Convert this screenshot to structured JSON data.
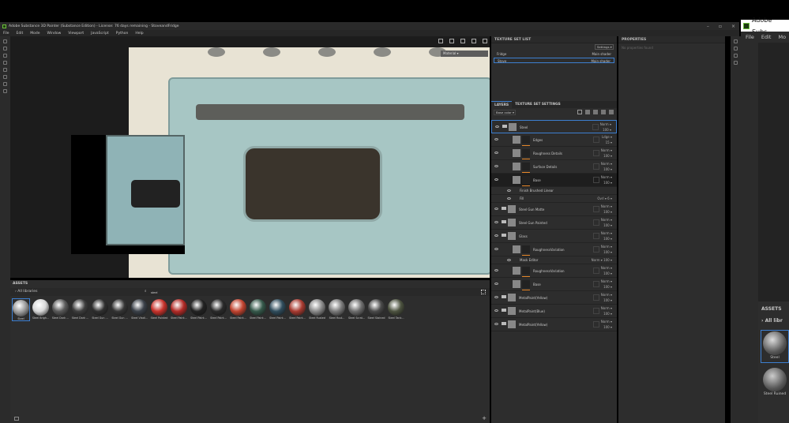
{
  "window": {
    "title": "Adobe Substance 3D Painter (Substance Edition) - License: 76 days remaining - StoveandFridge"
  },
  "menu": [
    "File",
    "Edit",
    "Mode",
    "Window",
    "Viewport",
    "JavaScript",
    "Python",
    "Help"
  ],
  "viewport": {
    "material_mode": "Material"
  },
  "texture_set_list": {
    "title": "TEXTURE SET LIST",
    "settings": "Settings",
    "items": [
      {
        "name": "Fridge",
        "shader": "Main shader"
      },
      {
        "name": "Stove",
        "shader": "Main shader",
        "selected": true
      }
    ]
  },
  "properties": {
    "title": "PROPERTIES",
    "empty": "No properties found"
  },
  "layers": {
    "tabs": [
      "LAYERS",
      "TEXTURE SET SETTINGS"
    ],
    "channel": "Base color",
    "rows": [
      {
        "name": "Steel",
        "type": "folder",
        "blend": "Norm",
        "opacity": "100",
        "indent": 0,
        "selected": true
      },
      {
        "name": "Edges",
        "type": "fill",
        "blend": "Ldge",
        "opacity": "15",
        "indent": 1
      },
      {
        "name": "Roughness Details",
        "type": "fill",
        "blend": "Norm",
        "opacity": "100",
        "indent": 1
      },
      {
        "name": "Surface Details",
        "type": "fill",
        "blend": "Norm",
        "opacity": "100",
        "indent": 1
      },
      {
        "name": "Base",
        "type": "fill",
        "blend": "Norm",
        "opacity": "100",
        "indent": 1,
        "active": true
      },
      {
        "name": "Finish Brushed Linear",
        "type": "effect",
        "indent": 2
      },
      {
        "name": "Fill",
        "type": "effect",
        "blend": "Ovrl",
        "opacity": "6",
        "indent": 2
      },
      {
        "name": "Steel Gun Matte",
        "type": "folder",
        "blend": "Norm",
        "opacity": "100",
        "indent": 0
      },
      {
        "name": "Steel Gun Painted",
        "type": "folder",
        "blend": "Norm",
        "opacity": "100",
        "indent": 0
      },
      {
        "name": "Glass",
        "type": "folder",
        "blend": "Norm",
        "opacity": "100",
        "indent": 0
      },
      {
        "name": "RoughnessVariation",
        "type": "fill",
        "blend": "Norm",
        "opacity": "100",
        "indent": 1
      },
      {
        "name": "Mask Editor",
        "type": "effect",
        "blend": "Norm",
        "opacity": "100",
        "indent": 2
      },
      {
        "name": "RoughnessVariation",
        "type": "fill",
        "blend": "Norm",
        "opacity": "100",
        "indent": 1
      },
      {
        "name": "Base",
        "type": "fill",
        "blend": "Norm",
        "opacity": "100",
        "indent": 1
      },
      {
        "name": "MetalPaint(Yellow)",
        "type": "folder",
        "blend": "Norm",
        "opacity": "100",
        "indent": 0
      },
      {
        "name": "MetalPaint(Blue)",
        "type": "folder",
        "blend": "Norm",
        "opacity": "100",
        "indent": 0
      },
      {
        "name": "MetalPaint(Yellow)",
        "type": "folder",
        "blend": "Norm",
        "opacity": "100",
        "indent": 0
      }
    ]
  },
  "assets": {
    "title": "ASSETS",
    "library": "All libraries",
    "search": "steel",
    "items": [
      {
        "name": "Steel",
        "color": "#9a9a9a"
      },
      {
        "name": "Steel Brigh...",
        "color": "#d8d8d8"
      },
      {
        "name": "Steel Dark ...",
        "color": "#5a5a5a"
      },
      {
        "name": "Steel Dark ...",
        "color": "#3e3e3e"
      },
      {
        "name": "Steel Gun ...",
        "color": "#303030"
      },
      {
        "name": "Steel Gun ...",
        "color": "#353535"
      },
      {
        "name": "Steel Vladi...",
        "color": "#3a4048"
      },
      {
        "name": "Steel Painted",
        "color": "#c8322b"
      },
      {
        "name": "Steel Paint...",
        "color": "#b22a26"
      },
      {
        "name": "Steel Paint...",
        "color": "#222"
      },
      {
        "name": "Steel Paint...",
        "color": "#2a2a2a"
      },
      {
        "name": "Steel Paint...",
        "color": "#c0432f"
      },
      {
        "name": "Steel Paint...",
        "color": "#35584a"
      },
      {
        "name": "Steel Paint...",
        "color": "#2f4c5c"
      },
      {
        "name": "Steel Paint...",
        "color": "#a83a30"
      },
      {
        "name": "Steel Rusted",
        "color": "#8a8a8a"
      },
      {
        "name": "Steel Rust...",
        "color": "#7a7a7a"
      },
      {
        "name": "Steel Scrat...",
        "color": "#6e6e6e"
      },
      {
        "name": "Steel Stained",
        "color": "#4a4a4a"
      },
      {
        "name": "Steel Tank...",
        "color": "#4d5340"
      }
    ]
  },
  "second_window": {
    "title": "Adobe Subs",
    "menu": [
      "File",
      "Edit",
      "Mo"
    ],
    "assets_title": "ASSETS",
    "library": "All libr",
    "items": [
      "Steel",
      "Steel Ruined"
    ]
  }
}
